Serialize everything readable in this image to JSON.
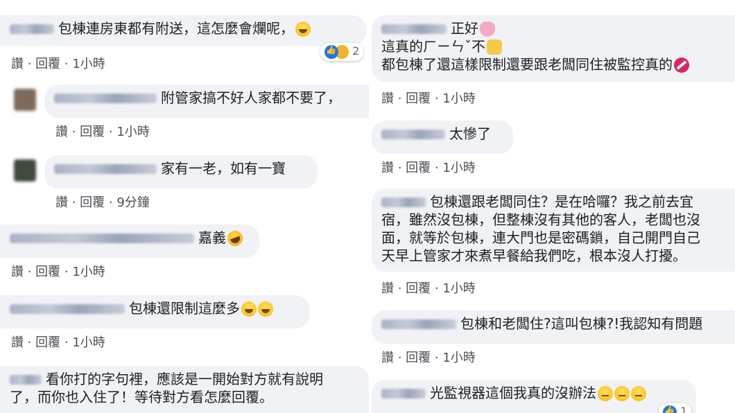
{
  "actions": {
    "like": "讚",
    "sep": " · ",
    "reply": "回覆"
  },
  "left": [
    {
      "text": "包棟連房東都有附送，這怎麼會爛呢，",
      "emoji": [
        "smile"
      ],
      "time": "1小時",
      "reaction_count": "2"
    },
    {
      "text": "附管家搞不好人家都不要了，",
      "time": "1小時"
    },
    {
      "text": "家有一老，如有一寶",
      "time": "9分鐘"
    },
    {
      "text": "嘉義",
      "emoji": [
        "laugh"
      ],
      "time": "1小時"
    },
    {
      "text": "包棟還限制這麼多",
      "emoji": [
        "smile",
        "smile"
      ],
      "time": "1小時"
    },
    {
      "lines": [
        "看你打的字句裡，應該是一開始對方就有說明",
        "了，而你也入住了！等待對方看怎麼回覆。"
      ]
    }
  ],
  "right": [
    {
      "lines": [
        "正好",
        "這真的ㄏㄧㄣˇ不",
        "都包棟了還這樣限制還要跟老闆同住被監控真的"
      ],
      "emoji_line": [
        "octo",
        "hand",
        "noentry"
      ],
      "time": "1小時"
    },
    {
      "text": "太慘了",
      "time": "1小時"
    },
    {
      "lines": [
        "包棟還跟老闆同住？是在哈囉？我之前去宜",
        "宿，雖然沒包棟，但整棟沒有其他的客人，老闆也沒",
        "面，就等於包棟，連大門也是密碼鎖，自己開門自己",
        "天早上管家才來煮早餐給我們吃，根本沒人打擾。"
      ],
      "time": "1小時"
    },
    {
      "text": "包棟和老闆住?這叫包棟?!我認知有問題",
      "time": "1小時"
    },
    {
      "text": "光監視器這個我真的沒辦法",
      "emoji": [
        "meh",
        "meh",
        "meh"
      ],
      "reaction_count": "1"
    }
  ]
}
